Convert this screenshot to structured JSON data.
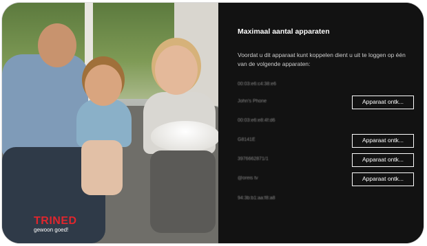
{
  "brand": {
    "name": "TRINED",
    "tagline": "gewoon goed!",
    "color": "#e0262d"
  },
  "dialog": {
    "title": "Maximaal aantal apparaten",
    "description": "Voordat u dit apparaat kunt koppelen dient u uit te loggen op één van de volgende apparaten:",
    "devices": [
      {
        "name": "00:03:e6:c4:38:e6",
        "button": ""
      },
      {
        "name": "John's Phone",
        "button": "Apparaat ontk..."
      },
      {
        "name": "00:03:e6:e8:4f:d6",
        "button": ""
      },
      {
        "name": "G8141E",
        "button": "Apparaat ontk..."
      },
      {
        "name": "3976662871/1",
        "button": "Apparaat ontk..."
      },
      {
        "name": "@oreis tv",
        "button": "Apparaat ontk..."
      },
      {
        "name": "94:3b:b1:aa:f8:a8",
        "button": ""
      }
    ]
  }
}
